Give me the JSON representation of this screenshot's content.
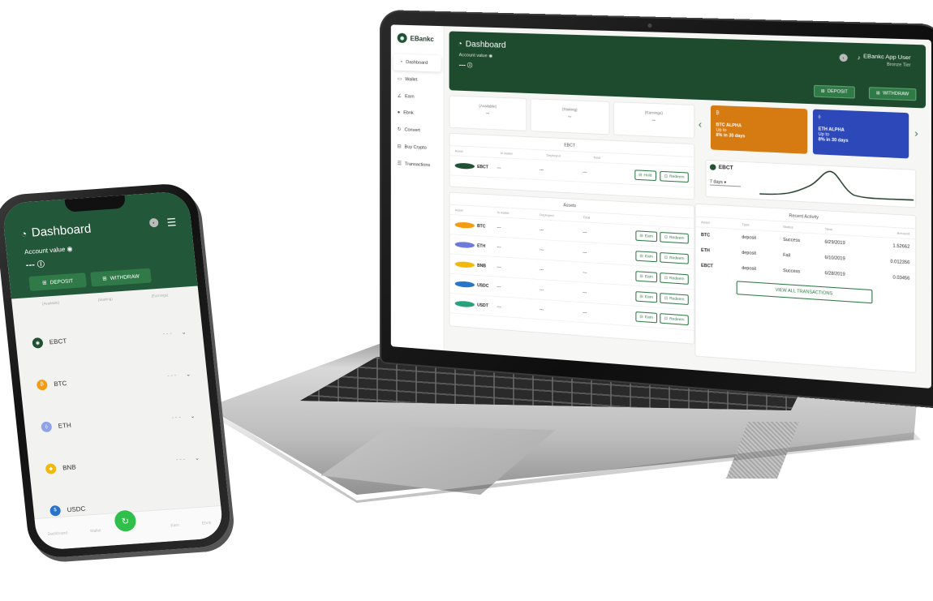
{
  "desktop": {
    "brand": "EBankc",
    "nav": [
      {
        "label": "Dashboard",
        "icon": "gauge-icon"
      },
      {
        "label": "Wallet",
        "icon": "wallet-icon"
      },
      {
        "label": "Earn",
        "icon": "earn-icon"
      },
      {
        "label": "Ebnk",
        "icon": "coin-icon"
      },
      {
        "label": "Convert",
        "icon": "convert-icon"
      },
      {
        "label": "Buy Crypto",
        "icon": "cart-icon"
      },
      {
        "label": "Transactions",
        "icon": "list-icon"
      }
    ],
    "header": {
      "title": "Dashboard",
      "account_label": "Account value",
      "account_value": "---",
      "user_name": "EBankc App User",
      "tier": "Bronze Tier",
      "deposit": "DEPOSIT",
      "withdraw": "WITHDRAW"
    },
    "stats": [
      {
        "label": "(Available)",
        "value": "--"
      },
      {
        "label": "(Staking)",
        "value": "--"
      },
      {
        "label": "(Earnings)",
        "value": "--"
      }
    ],
    "ebct": {
      "title": "EBCT",
      "columns": [
        "Asset",
        "In wallet",
        "Deployed",
        "Total"
      ],
      "row": {
        "coin": "EBCT",
        "wallet": "---",
        "deployed": "---",
        "total": "---"
      },
      "hold": "Hold",
      "redeem": "Redeem"
    },
    "assets": {
      "title": "Assets",
      "columns": [
        "Asset",
        "In wallet",
        "Deployed",
        "Total"
      ],
      "rows": [
        {
          "coin": "BTC",
          "wallet": "---",
          "deployed": "---",
          "total": "---",
          "color": "#f39c12"
        },
        {
          "coin": "ETH",
          "wallet": "---",
          "deployed": "---",
          "total": "---",
          "color": "#6c7bd9"
        },
        {
          "coin": "BNB",
          "wallet": "---",
          "deployed": "---",
          "total": "---",
          "color": "#f0b90b"
        },
        {
          "coin": "USDC",
          "wallet": "---",
          "deployed": "---",
          "total": "---",
          "color": "#2775ca"
        },
        {
          "coin": "USDT",
          "wallet": "---",
          "deployed": "---",
          "total": "---",
          "color": "#26a17b"
        }
      ],
      "earn": "Earn",
      "redeem": "Redeem"
    },
    "promos": [
      {
        "title": "BTC ALPHA",
        "line1": "Up to",
        "line2": "8% in 30 days",
        "color": "#d67a12"
      },
      {
        "title": "ETH ALPHA",
        "line1": "Up to",
        "line2": "8% in 30 days",
        "color": "#2d48b8"
      }
    ],
    "chart": {
      "coin": "EBCT",
      "range": "7 days"
    },
    "activity": {
      "title": "Recent Activity",
      "columns": [
        "Asset",
        "Type",
        "Status",
        "Time",
        "Amount"
      ],
      "rows": [
        {
          "asset": "BTC",
          "type": "deposit",
          "status": "Success",
          "time": "6/29/2019",
          "amount": "1.52662"
        },
        {
          "asset": "ETH",
          "type": "deposit",
          "status": "Fail",
          "time": "6/10/2019",
          "amount": "0.012356"
        },
        {
          "asset": "EBCT",
          "type": "deposit",
          "status": "Success",
          "time": "6/28/2019",
          "amount": "0.03456"
        }
      ],
      "view_all": "VIEW ALL TRANSACTIONS"
    }
  },
  "mobile": {
    "title": "Dashboard",
    "account_label": "Account value",
    "account_value": "---",
    "deposit": "DEPOSIT",
    "withdraw": "WITHDRAW",
    "coins": [
      {
        "label": "EBCT",
        "color": "#1f5132"
      },
      {
        "label": "BTC",
        "color": "#f39c12"
      },
      {
        "label": "ETH",
        "color": "#8fa3e8"
      },
      {
        "label": "BNB",
        "color": "#f0b90b"
      },
      {
        "label": "USDC",
        "color": "#2775ca"
      }
    ],
    "nav": [
      "Dashboard",
      "Wallet",
      "Earn",
      "Ebnk"
    ]
  }
}
